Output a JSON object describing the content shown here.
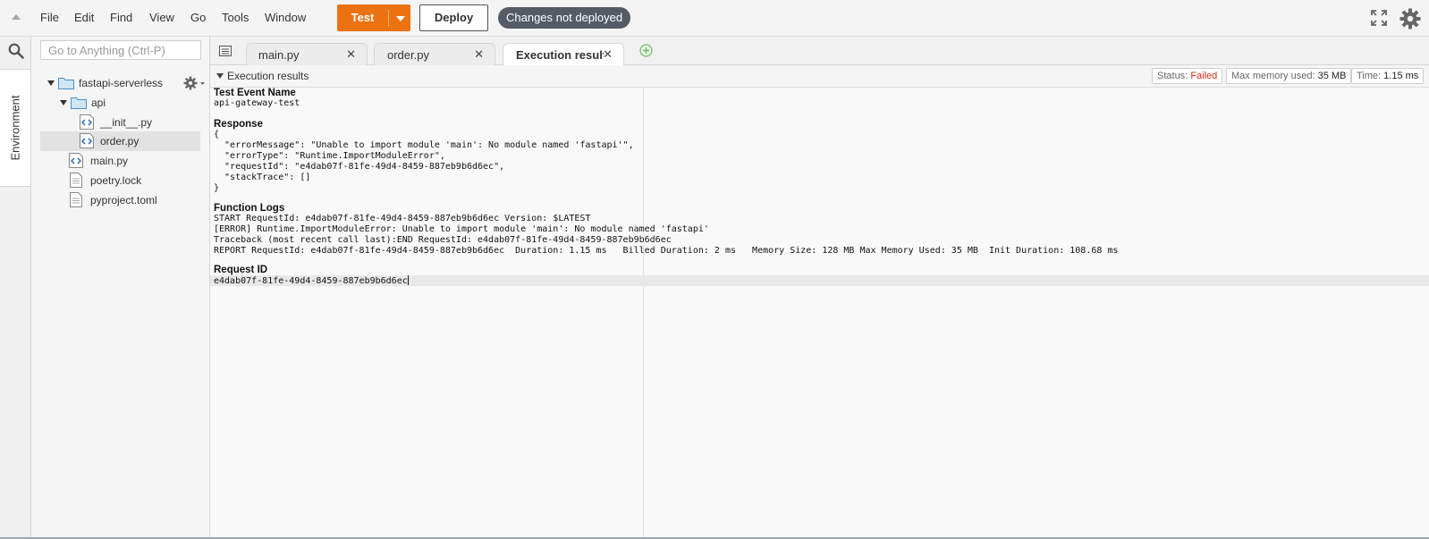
{
  "menu": [
    "File",
    "Edit",
    "Find",
    "View",
    "Go",
    "Tools",
    "Window"
  ],
  "toolbar": {
    "test_label": "Test",
    "deploy_label": "Deploy",
    "status_badge": "Changes not deployed"
  },
  "sidebar": {
    "tab_label": "Environment",
    "search_placeholder": "Go to Anything (Ctrl-P)"
  },
  "tree": {
    "root": "fastapi-serverless",
    "folder": "api",
    "files_in_folder": [
      "__init__.py",
      "order.py"
    ],
    "root_files": [
      "main.py",
      "poetry.lock",
      "pyproject.toml"
    ],
    "selected": "order.py"
  },
  "tabs": [
    {
      "label": "main.py",
      "active": false
    },
    {
      "label": "order.py",
      "active": false
    },
    {
      "label": "Execution results",
      "active": true
    }
  ],
  "results": {
    "header": "Execution results",
    "status_label": "Status:",
    "status_value": "Failed",
    "memory_label": "Max memory used:",
    "memory_value": "35 MB",
    "time_label": "Time:",
    "time_value": "1.15 ms",
    "test_event_title": "Test Event Name",
    "test_event_value": "api-gateway-test",
    "response_title": "Response",
    "response_text": "{\n  \"errorMessage\": \"Unable to import module 'main': No module named 'fastapi'\",\n  \"errorType\": \"Runtime.ImportModuleError\",\n  \"requestId\": \"e4dab07f-81fe-49d4-8459-887eb9b6d6ec\",\n  \"stackTrace\": []\n}",
    "logs_title": "Function Logs",
    "logs_text": "START RequestId: e4dab07f-81fe-49d4-8459-887eb9b6d6ec Version: $LATEST\n[ERROR] Runtime.ImportModuleError: Unable to import module 'main': No module named 'fastapi'\nTraceback (most recent call last):END RequestId: e4dab07f-81fe-49d4-8459-887eb9b6d6ec\nREPORT RequestId: e4dab07f-81fe-49d4-8459-887eb9b6d6ec  Duration: 1.15 ms   Billed Duration: 2 ms   Memory Size: 128 MB Max Memory Used: 35 MB  Init Duration: 108.68 ms",
    "request_id_title": "Request ID",
    "request_id_value": "e4dab07f-81fe-49d4-8459-887eb9b6d6ec"
  },
  "colors": {
    "accent": "#ec7211",
    "badge": "#545b64",
    "status_failed": "#d13212"
  },
  "icons": [
    "collapse-icon",
    "search-icon",
    "fullscreen-icon",
    "settings-icon",
    "folder-icon",
    "python-file-icon",
    "text-file-icon",
    "add-tab-icon",
    "tabs-list-icon"
  ]
}
